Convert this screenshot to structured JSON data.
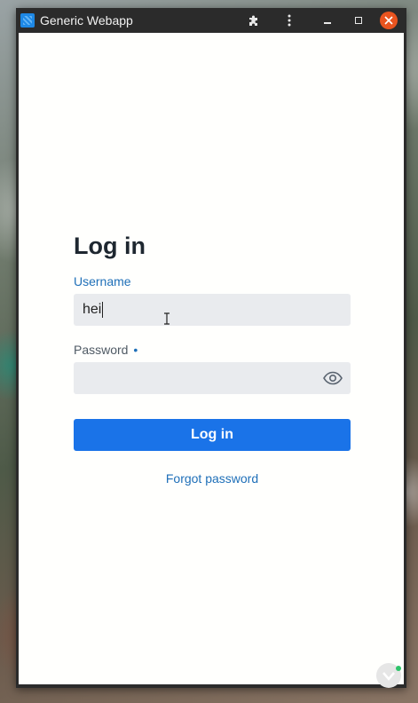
{
  "window": {
    "title": "Generic Webapp",
    "icons": {
      "app": "app-grid-icon",
      "extensions": "puzzle-piece-icon",
      "more": "vertical-dots-icon",
      "minimize": "minimize-icon",
      "maximize": "maximize-icon",
      "close": "close-icon"
    }
  },
  "login": {
    "heading": "Log in",
    "username": {
      "label": "Username",
      "value": "hei"
    },
    "password": {
      "label": "Password",
      "required_marker": "•",
      "value": "",
      "toggle_icon": "eye-icon"
    },
    "submit_label": "Log in",
    "forgot_label": "Forgot password"
  },
  "colors": {
    "accent": "#1a73e8",
    "link": "#1e6fb8",
    "close_button": "#e9541f",
    "field_bg": "#e9ebee"
  }
}
